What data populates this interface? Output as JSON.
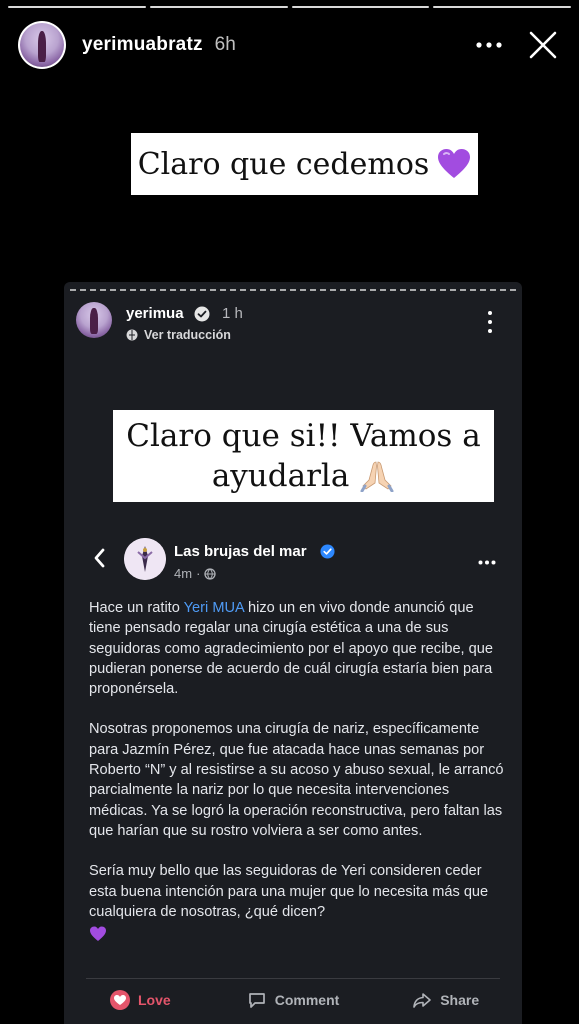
{
  "story": {
    "progress_segments": 4,
    "username": "yerimuabratz",
    "time": "6h",
    "caption": "Claro que cedemos",
    "icons": {
      "more": "more-horizontal-icon",
      "close": "close-icon"
    }
  },
  "post": {
    "username": "yerimua",
    "time": "1 h",
    "translate_label": "Ver traducción",
    "note_line1": "Claro que si!! Vamos a",
    "note_line2": "ayudarla"
  },
  "shared_post": {
    "page_name": "Las brujas del mar",
    "time": "4m",
    "body_p1_before": "Hace un ratito ",
    "mention": "Yeri MUA",
    "body_p1_after": " hizo un en vivo donde anunció que tiene pensado regalar una cirugía estética a una de sus seguidoras como agradecimiento por el apoyo que recibe, que pudieran ponerse de acuerdo de cuál cirugía estaría bien para proponérsela.",
    "body_p2": "Nosotras proponemos una cirugía de nariz, específicamente para Jazmín Pérez, que fue atacada hace unas semanas por Roberto “N” y al resistirse a su acoso y abuso sexual, le arrancó parcialmente la nariz por lo que necesita intervenciones médicas. Ya se logró la operación reconstructiva, pero faltan las que harían que su rostro volviera a ser como antes.",
    "body_p3": "Sería muy bello que las seguidoras de Yeri consideren ceder esta buena intención para una mujer que lo necesita más que cualquiera de nosotras, ¿qué dicen?",
    "actions": {
      "love": "Love",
      "comment": "Comment",
      "share": "Share"
    }
  },
  "colors": {
    "background": "#000000",
    "card": "#1b1d22",
    "mention": "#4f9bf5",
    "love": "#e4556b",
    "heart_emoji": "#a24ce0"
  }
}
